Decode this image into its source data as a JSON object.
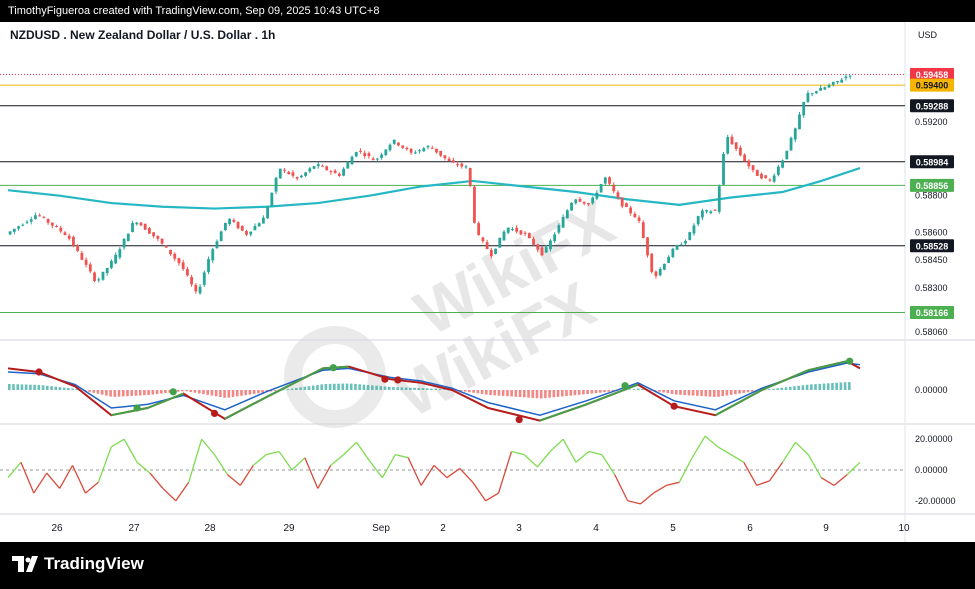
{
  "header": {
    "attribution": "TimothyFigueroa created with TradingView.com, Sep 09, 2025 10:43 UTC+8"
  },
  "footer": {
    "logo_text": "TradingView"
  },
  "watermark": {
    "text": "WikiFX"
  },
  "colors": {
    "bull": "#26a69a",
    "bear": "#ef5350",
    "ma": "#26b7c4",
    "macd_line": "#b71c1c",
    "signal_line": "#43a047",
    "macd_blue": "#1e63c8",
    "osc_up": "#7ddc4f",
    "osc_down": "#d94a3a",
    "current_price_bg": "#f23645",
    "gold_level_bg": "#f5b400",
    "green_level_bg": "#4caf50",
    "black_level_bg": "#131722"
  },
  "chart_data": {
    "type": "candlestick",
    "title": "NZDUSD . New Zealand Dollar / U.S. Dollar . 1h",
    "currency": "USD",
    "y_range": [
      0.5806,
      0.5958
    ],
    "x_labels": [
      "26",
      "27",
      "28",
      "29",
      "Sep",
      "2",
      "3",
      "4",
      "5",
      "6",
      "9",
      "10"
    ],
    "y_ticks": [
      "0.59200",
      "0.58800",
      "0.58600",
      "0.58450",
      "0.58300",
      "0.58060"
    ],
    "levels": [
      {
        "label": "0.59458",
        "value": 0.59458,
        "style": "current"
      },
      {
        "label": "0.59400",
        "value": 0.594,
        "style": "gold"
      },
      {
        "label": "0.59288",
        "value": 0.59288,
        "style": "black"
      },
      {
        "label": "0.58984",
        "value": 0.58984,
        "style": "black"
      },
      {
        "label": "0.58856",
        "value": 0.58856,
        "style": "green"
      },
      {
        "label": "0.58528",
        "value": 0.58528,
        "style": "black"
      },
      {
        "label": "0.58166",
        "value": 0.58166,
        "style": "green"
      }
    ],
    "price_path": [
      [
        0.0,
        0.5859
      ],
      [
        1.2,
        0.587
      ],
      [
        2.4,
        0.5858
      ],
      [
        3.5,
        0.5833
      ],
      [
        4.2,
        0.5846
      ],
      [
        5.0,
        0.5867
      ],
      [
        5.9,
        0.5856
      ],
      [
        6.8,
        0.5842
      ],
      [
        7.4,
        0.5826
      ],
      [
        7.9,
        0.5848
      ],
      [
        8.6,
        0.5868
      ],
      [
        9.3,
        0.5859
      ],
      [
        10.0,
        0.5868
      ],
      [
        10.6,
        0.5895
      ],
      [
        11.3,
        0.5889
      ],
      [
        12.0,
        0.5897
      ],
      [
        12.9,
        0.5891
      ],
      [
        13.6,
        0.5905
      ],
      [
        14.3,
        0.5899
      ],
      [
        15.0,
        0.591
      ],
      [
        15.7,
        0.5903
      ],
      [
        16.4,
        0.5907
      ],
      [
        17.2,
        0.5898
      ],
      [
        17.9,
        0.5895
      ],
      [
        18.2,
        0.586
      ],
      [
        18.8,
        0.5848
      ],
      [
        19.4,
        0.5863
      ],
      [
        20.1,
        0.5859
      ],
      [
        20.8,
        0.5848
      ],
      [
        21.4,
        0.5863
      ],
      [
        22.0,
        0.5879
      ],
      [
        22.6,
        0.5875
      ],
      [
        23.2,
        0.589
      ],
      [
        23.8,
        0.5876
      ],
      [
        24.5,
        0.5867
      ],
      [
        25.1,
        0.5835
      ],
      [
        25.8,
        0.585
      ],
      [
        26.4,
        0.5857
      ],
      [
        26.9,
        0.5871
      ],
      [
        27.5,
        0.5872
      ],
      [
        27.9,
        0.5913
      ],
      [
        28.4,
        0.5903
      ],
      [
        29.0,
        0.5892
      ],
      [
        29.6,
        0.5888
      ],
      [
        30.1,
        0.59
      ],
      [
        30.6,
        0.5917
      ],
      [
        31.0,
        0.5935
      ],
      [
        31.6,
        0.5938
      ],
      [
        32.2,
        0.5942
      ],
      [
        32.7,
        0.5946
      ]
    ],
    "moving_average": [
      [
        0.0,
        0.5883
      ],
      [
        2.0,
        0.588
      ],
      [
        4.0,
        0.5876
      ],
      [
        6.0,
        0.5874
      ],
      [
        8.0,
        0.5873
      ],
      [
        10.0,
        0.5874
      ],
      [
        12.0,
        0.5876
      ],
      [
        14.0,
        0.588
      ],
      [
        16.0,
        0.5885
      ],
      [
        18.0,
        0.5888
      ],
      [
        20.0,
        0.5885
      ],
      [
        22.0,
        0.5882
      ],
      [
        24.0,
        0.5878
      ],
      [
        26.0,
        0.5875
      ],
      [
        28.0,
        0.5879
      ],
      [
        30.0,
        0.5882
      ],
      [
        31.5,
        0.5888
      ],
      [
        33.0,
        0.5895
      ]
    ],
    "macd": {
      "zero_label": "0.00000",
      "macd_line": [
        [
          0,
          0.6
        ],
        [
          1.2,
          0.5
        ],
        [
          2.6,
          0.1
        ],
        [
          4.0,
          -0.7
        ],
        [
          5.4,
          -0.5
        ],
        [
          6.8,
          -0.1
        ],
        [
          8.4,
          -0.8
        ],
        [
          10.0,
          -0.2
        ],
        [
          12.2,
          0.6
        ],
        [
          13.2,
          0.65
        ],
        [
          14.8,
          0.3
        ],
        [
          16.0,
          0.2
        ],
        [
          17.2,
          0.0
        ],
        [
          18.6,
          -0.5
        ],
        [
          20.6,
          -0.85
        ],
        [
          22.4,
          -0.4
        ],
        [
          24.4,
          0.15
        ],
        [
          25.8,
          -0.45
        ],
        [
          27.4,
          -0.7
        ],
        [
          29.2,
          0.0
        ],
        [
          31.0,
          0.55
        ],
        [
          32.5,
          0.8
        ],
        [
          33.0,
          0.6
        ]
      ],
      "signal_line": [
        [
          0,
          0.5
        ],
        [
          1.2,
          0.45
        ],
        [
          2.6,
          0.15
        ],
        [
          4.0,
          -0.5
        ],
        [
          5.4,
          -0.4
        ],
        [
          6.8,
          -0.15
        ],
        [
          8.4,
          -0.55
        ],
        [
          10.0,
          -0.05
        ],
        [
          12.2,
          0.55
        ],
        [
          13.2,
          0.6
        ],
        [
          14.8,
          0.35
        ],
        [
          16.0,
          0.25
        ],
        [
          17.2,
          0.05
        ],
        [
          18.6,
          -0.35
        ],
        [
          20.6,
          -0.7
        ],
        [
          22.4,
          -0.3
        ],
        [
          24.4,
          0.2
        ],
        [
          25.8,
          -0.3
        ],
        [
          27.4,
          -0.55
        ],
        [
          29.2,
          0.05
        ],
        [
          31.0,
          0.5
        ],
        [
          32.5,
          0.75
        ],
        [
          33.0,
          0.7
        ]
      ],
      "cross_markers": [
        [
          1.2,
          0.5
        ],
        [
          5.0,
          -0.5
        ],
        [
          6.4,
          -0.05
        ],
        [
          8.0,
          -0.65
        ],
        [
          12.6,
          0.62
        ],
        [
          14.6,
          0.3
        ],
        [
          15.1,
          0.28
        ],
        [
          19.8,
          -0.82
        ],
        [
          23.9,
          0.12
        ],
        [
          25.8,
          -0.45
        ],
        [
          32.6,
          0.8
        ]
      ]
    },
    "oscillator": {
      "y_ticks": [
        "20.00000",
        "0.00000",
        "-20.00000"
      ],
      "y_range": [
        -26,
        26
      ],
      "values": [
        [
          0,
          -5
        ],
        [
          0.5,
          5
        ],
        [
          1.0,
          -15
        ],
        [
          1.5,
          -2
        ],
        [
          2.0,
          -12
        ],
        [
          2.5,
          3
        ],
        [
          3.0,
          -15
        ],
        [
          3.5,
          -8
        ],
        [
          4.0,
          15
        ],
        [
          4.5,
          20
        ],
        [
          5.0,
          5
        ],
        [
          5.5,
          -2
        ],
        [
          6.0,
          -12
        ],
        [
          6.5,
          -20
        ],
        [
          7.0,
          -8
        ],
        [
          7.5,
          20
        ],
        [
          8.0,
          10
        ],
        [
          8.5,
          -3
        ],
        [
          9.0,
          -10
        ],
        [
          9.5,
          3
        ],
        [
          10.0,
          10
        ],
        [
          10.5,
          12
        ],
        [
          11.0,
          0
        ],
        [
          11.5,
          8
        ],
        [
          12.0,
          -12
        ],
        [
          12.5,
          3
        ],
        [
          13.0,
          10
        ],
        [
          13.5,
          18
        ],
        [
          14.0,
          6
        ],
        [
          14.5,
          -5
        ],
        [
          15.0,
          10
        ],
        [
          15.5,
          8
        ],
        [
          16.0,
          -10
        ],
        [
          16.5,
          3
        ],
        [
          17.0,
          -5
        ],
        [
          17.5,
          1
        ],
        [
          18.0,
          -8
        ],
        [
          18.5,
          -20
        ],
        [
          19.0,
          -15
        ],
        [
          19.5,
          12
        ],
        [
          20.0,
          10
        ],
        [
          20.5,
          2
        ],
        [
          21.0,
          12
        ],
        [
          21.5,
          20
        ],
        [
          22.0,
          5
        ],
        [
          22.5,
          12
        ],
        [
          23.0,
          10
        ],
        [
          23.5,
          -3
        ],
        [
          24.0,
          -20
        ],
        [
          24.5,
          -22
        ],
        [
          25.0,
          -15
        ],
        [
          25.5,
          -10
        ],
        [
          26.0,
          -8
        ],
        [
          26.5,
          8
        ],
        [
          27.0,
          22
        ],
        [
          27.5,
          15
        ],
        [
          28.0,
          10
        ],
        [
          28.5,
          5
        ],
        [
          29.0,
          -10
        ],
        [
          29.5,
          -7
        ],
        [
          30.0,
          5
        ],
        [
          30.5,
          18
        ],
        [
          31.0,
          10
        ],
        [
          31.5,
          -5
        ],
        [
          32.0,
          -10
        ],
        [
          32.5,
          -3
        ],
        [
          33.0,
          5
        ]
      ]
    }
  }
}
